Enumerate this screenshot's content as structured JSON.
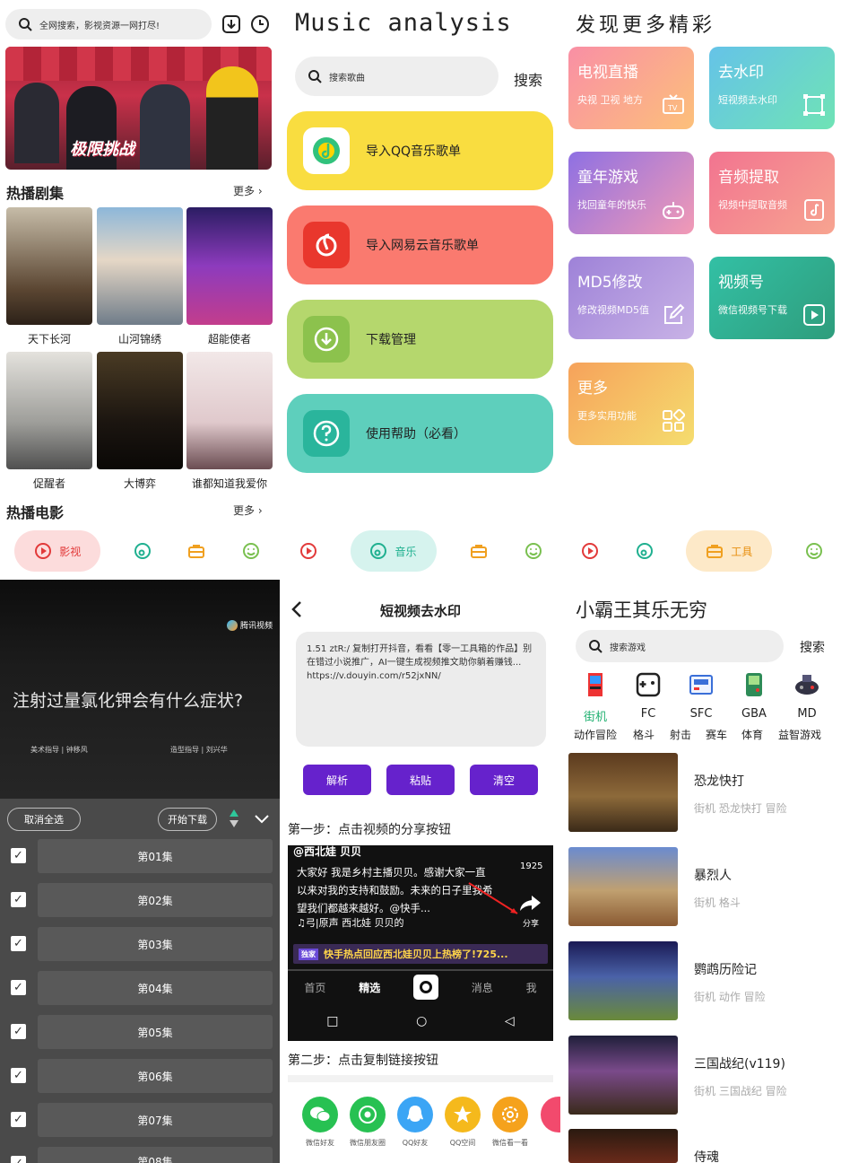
{
  "video_home": {
    "search_placeholder": "全网搜索，影视资源一网打尽!",
    "banner_text": "极限挑战",
    "section1_title": "热播剧集",
    "section1_more": "更多",
    "dramas": [
      {
        "name": "天下长河"
      },
      {
        "name": "山河锦绣"
      },
      {
        "name": "超能使者"
      },
      {
        "name": "促醒者"
      },
      {
        "name": "大博弈"
      },
      {
        "name": "谁都知道我爱你"
      }
    ],
    "section2_title": "热播电影",
    "section2_more": "更多",
    "nav_active_label": "影视"
  },
  "music": {
    "title": "Music analysis",
    "search_placeholder": "搜索歌曲",
    "search_button": "搜索",
    "cards": [
      {
        "label": "导入QQ音乐歌单",
        "color": "#f9dd40"
      },
      {
        "label": "导入网易云音乐歌单",
        "color": "#fa7a6f"
      },
      {
        "label": "下载管理",
        "color": "#b5d76d"
      },
      {
        "label": "使用帮助（必看）",
        "color": "#5ecfbc"
      }
    ],
    "nav_active_label": "音乐"
  },
  "tools": {
    "title": "发现更多精彩",
    "cards": [
      {
        "title": "电视直播",
        "sub": "央视 卫视 地方",
        "icon": "tv-icon"
      },
      {
        "title": "去水印",
        "sub": "短视频去水印",
        "icon": "crop-icon"
      },
      {
        "title": "童年游戏",
        "sub": "找回童年的快乐",
        "icon": "gamepad-icon"
      },
      {
        "title": "音频提取",
        "sub": "视频中提取音频",
        "icon": "music-file-icon"
      },
      {
        "title": "MD5修改",
        "sub": "修改视频MD5值",
        "icon": "edit-icon"
      },
      {
        "title": "视频号",
        "sub": "微信视频号下载",
        "icon": "play-icon"
      },
      {
        "title": "更多",
        "sub": "更多实用功能",
        "icon": "grid-icon"
      }
    ],
    "nav_active_label": "工具"
  },
  "episodes": {
    "video_caption": "注射过量氯化钾会有什么症状?",
    "credits_left": "美术指导 | 钟移风",
    "credits_right": "造型指导 | 刘兴华",
    "logo_text": "腾讯视频",
    "cancel_all": "取消全选",
    "start_download": "开始下载",
    "items": [
      "第01集",
      "第02集",
      "第03集",
      "第04集",
      "第05集",
      "第06集",
      "第07集",
      "第08集"
    ]
  },
  "watermark": {
    "title": "短视频去水印",
    "input_text": "1.51 ztR:/ 复制打开抖音，看看【零一工具箱的作品】别在错过小说推广，AI一键生成视频推文助你躺着赚钱... https://v.douyin.com/r52jxNN/",
    "buttons": [
      "解析",
      "粘贴",
      "清空"
    ],
    "step1": "第一步：点击视频的分享按钮",
    "step2": "第二步：点击复制链接按钮",
    "video": {
      "author": "@西北娃 贝贝",
      "caption": "大家好 我是乡村主播贝贝。感谢大家一直以来对我的支持和鼓励。未来的日子里我希望我们都越来越好。@快手...",
      "music": "♫弓|原声   西北娃 贝贝的",
      "comments": "1925",
      "share": "分享",
      "tag": "独家",
      "hot": "快手热点回应西北娃贝贝上热榜了!725...",
      "tabs": [
        "首页",
        "精选",
        "消息",
        "我"
      ]
    },
    "share_targets": [
      {
        "label": "微信好友",
        "color": "#27c152"
      },
      {
        "label": "微信朋友圈",
        "color": "#27c152"
      },
      {
        "label": "QQ好友",
        "color": "#3ba5f5"
      },
      {
        "label": "QQ空间",
        "color": "#f5b91c"
      },
      {
        "label": "微信看一看",
        "color": "#f5a21c"
      }
    ]
  },
  "games": {
    "title": "小霸王其乐无穷",
    "search_placeholder": "搜索游戏",
    "search_button": "搜索",
    "categories": [
      {
        "label": "街机",
        "active": true
      },
      {
        "label": "FC",
        "active": false
      },
      {
        "label": "SFC",
        "active": false
      },
      {
        "label": "GBA",
        "active": false
      },
      {
        "label": "MD",
        "active": false
      }
    ],
    "subcategories": [
      "动作冒险",
      "格斗",
      "射击",
      "赛车",
      "体育",
      "益智游戏"
    ],
    "list": [
      {
        "name": "恐龙快打",
        "tags": "街机 恐龙快打 冒险"
      },
      {
        "name": "暴烈人",
        "tags": "街机 格斗"
      },
      {
        "name": "鹦鹉历险记",
        "tags": "街机 动作 冒险"
      },
      {
        "name": "三国战纪(v119)",
        "tags": "街机 三国战纪 冒险"
      },
      {
        "name": "侍魂",
        "tags": ""
      }
    ]
  }
}
